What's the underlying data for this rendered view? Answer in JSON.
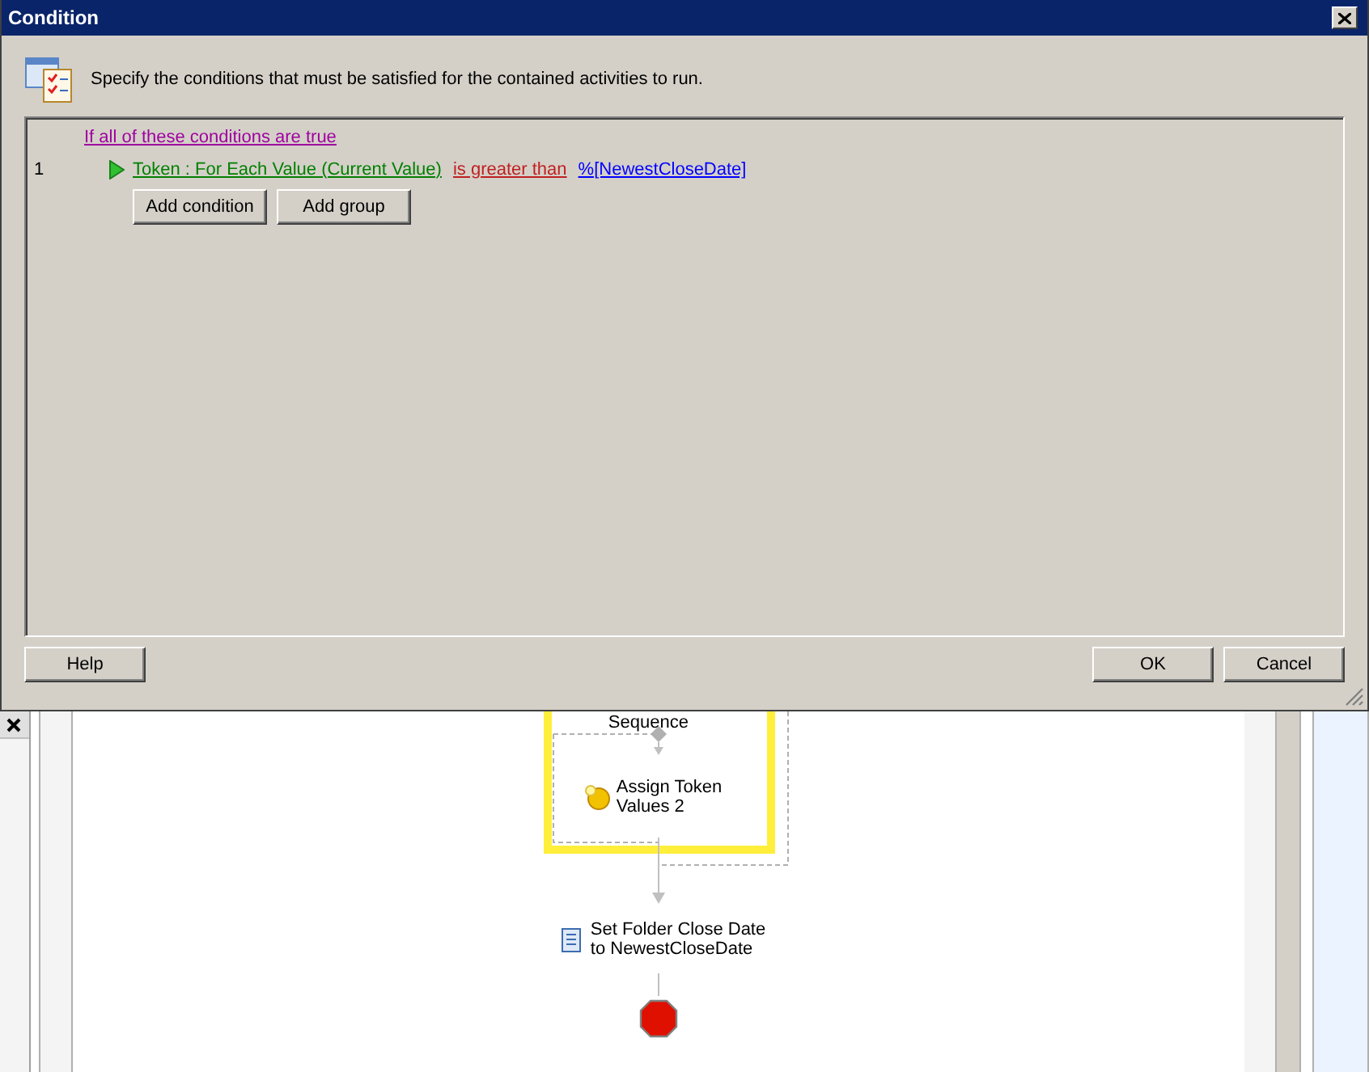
{
  "dialog": {
    "title": "Condition",
    "instruction": "Specify the conditions that must be satisfied for the contained activities to run.",
    "group_label": "If all of these conditions are true",
    "conditions": [
      {
        "number": "1",
        "field": "Token : For Each Value (Current Value)",
        "operator": "is greater than",
        "value": "%[NewestCloseDate]"
      }
    ],
    "actions": [
      "Add condition",
      "Add group"
    ],
    "buttons": {
      "help": "Help",
      "ok": "OK",
      "cancel": "Cancel"
    }
  },
  "workflow": {
    "sequence_label": "Sequence",
    "activities": [
      {
        "kind": "assign",
        "label": "Assign Token Values 2"
      },
      {
        "kind": "set",
        "label": "Set Folder Close Date to NewestCloseDate"
      }
    ]
  }
}
